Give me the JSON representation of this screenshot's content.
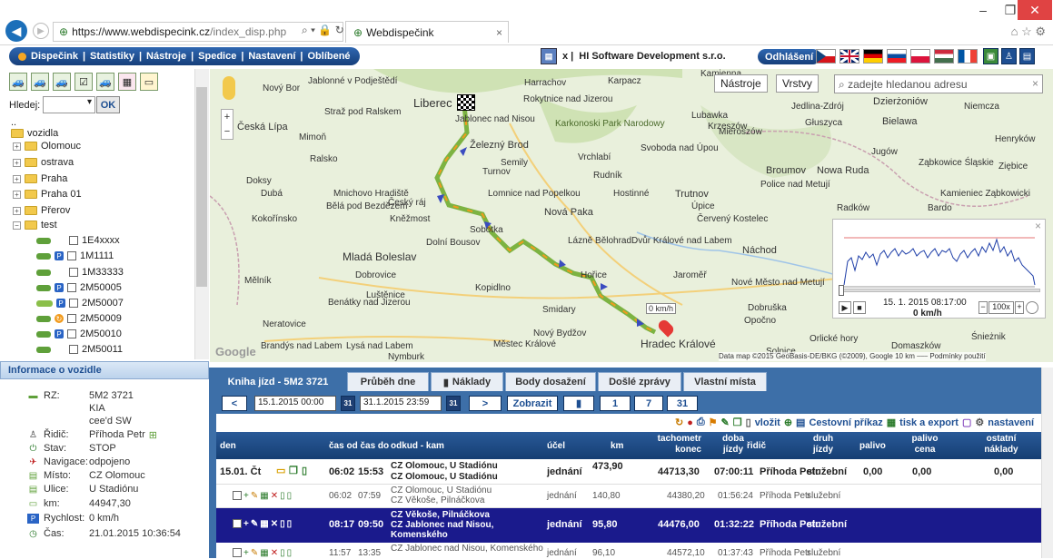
{
  "browser": {
    "url_host": "https://www.webdispecink.cz",
    "url_path": "/index_disp.php",
    "url_controls": "⌕ ▾ 🔒 ↻",
    "tab_title": "Webdispečink",
    "tab_close": "×",
    "win_min": "–",
    "win_max": "❐",
    "win_close": "✕",
    "right_icons": "⌂ ☆ ⚙"
  },
  "menu": {
    "items": [
      "Dispečink",
      "Statistiky",
      "Nástroje",
      "Spedice",
      "Nastavení",
      "Oblíbené"
    ],
    "company": "HI Software Development s.r.o.",
    "company_prefix": "x |",
    "logout": "Odhlášení",
    "flag_colors": [
      "#d7141a",
      "#012169",
      "#000000",
      "#0b4ea2",
      "#dc143c",
      "#436f4d",
      "#0055a4"
    ]
  },
  "left": {
    "search_label": "Hledej:",
    "ok": "OK",
    "tree_dots": "..",
    "root": "vozidla",
    "folders": [
      "Olomouc",
      "ostrava",
      "Praha",
      "Praha 01",
      "Přerov",
      "test"
    ],
    "vehicles": [
      "1E4xxxx",
      "1M1111",
      "1M33333",
      "2M50005",
      "2M50007",
      "2M50009",
      "2M50010",
      "2M50011"
    ]
  },
  "info": {
    "header": "Informace o vozidle",
    "rows": [
      {
        "label": "RZ:",
        "value": "5M2 3721"
      },
      {
        "label": "",
        "value": "KIA"
      },
      {
        "label": "",
        "value": "cee'd SW"
      },
      {
        "label": "Řidič:",
        "value": "Příhoda Petr"
      },
      {
        "label": "Stav:",
        "value": "STOP"
      },
      {
        "label": "Navigace:",
        "value": "odpojeno"
      },
      {
        "label": "Místo:",
        "value": "CZ Olomouc"
      },
      {
        "label": "Ulice:",
        "value": "U Stadiónu"
      },
      {
        "label": "km:",
        "value": "44947,30"
      },
      {
        "label": "Rychlost:",
        "value": "0 km/h"
      },
      {
        "label": "Čas:",
        "value": "21.01.2015 10:36:54"
      }
    ]
  },
  "map": {
    "btn_tools": "Nástroje",
    "btn_layers": "Vrstvy",
    "search_placeholder": "zadejte hledanou adresu",
    "search_clear": "×",
    "speed_badge": "0 km/h",
    "speed_time": "15. 1. 2015 08:17:00",
    "speed_value": "0 km/h",
    "speed_zoom": "100x",
    "speed_close": "×",
    "speed_minus": "−",
    "speed_plus": "+",
    "attribution": "Data map ©2015 GeoBasis-DE/BKG (©2009), Google   10 km ⎯⎯⎯   Podmínky použití",
    "google": "Google",
    "places": [
      "Liberec",
      "Jablonec nad Nisou",
      "Harrachov",
      "Karpacz",
      "Kamienna",
      "Nový Bor",
      "Jablonné v Podještědí",
      "Česká Lípa",
      "Mimoň",
      "Ralsko",
      "Straž pod Ralskem",
      "Rokytnice nad Jizerou",
      "Karkonoski Park Narodowy",
      "Krzeszów",
      "Lubawka",
      "Jedlina-Zdrój",
      "Dzierżoniów",
      "Niemcza",
      "Bielawa",
      "Głuszyca",
      "Henryków",
      "Železný Brod",
      "Semily",
      "Vrchlabí",
      "Svoboda nad Úpou",
      "Mieroszów",
      "Jugów",
      "Turnov",
      "Doksy",
      "Dubá",
      "Mnichovo Hradiště",
      "Český ráj",
      "Lomnice nad Popelkou",
      "Hostinné",
      "Trutnov",
      "Rudník",
      "Broumov",
      "Nowa Ruda",
      "Ząbkowice Śląskie",
      "Ziębice",
      "Bělá pod Bezdězem",
      "Kněžmost",
      "Nová Paka",
      "Úpice",
      "Police nad Metují",
      "Kamieniec Ząbkowicki",
      "Radków",
      "Bardo",
      "Kokořínsko",
      "Sobotka",
      "Červený Kostelec",
      "Mladá Boleslav",
      "Dolní Bousov",
      "Lázně Bělohrad",
      "Dvůr Králové nad Labem",
      "Náchod",
      "Mělník",
      "Dobrovice",
      "Hořice",
      "Jaroměř",
      "Nové Město nad Metují",
      "Kopidlno",
      "Luštěnice",
      "Benátky nad Jizerou",
      "Smidary",
      "Dobruška",
      "Opočno",
      "Neratovice",
      "Nový Bydžov",
      "Hradec Králové",
      "Brandýs nad Labem",
      "Lysá nad Labem",
      "Nymburk",
      "Městec Králové",
      "Solnice",
      "Orlické hory",
      "Domaszków",
      "Śnieżnik"
    ]
  },
  "bottom": {
    "tabs": [
      "Kniha jízd - 5M2 3721",
      "Průběh dne",
      "Náklady",
      "Body dosažení",
      "Došlé zprávy",
      "Vlastní místa"
    ],
    "filter": {
      "prev": "<",
      "next": ">",
      "from": "15.1.2015 00:00",
      "to": "31.1.2015 23:59",
      "show": "Zobrazit",
      "b1": "1",
      "b7": "7",
      "b31": "31",
      "cal": "31"
    },
    "toolbar": {
      "insert": "vložit",
      "travel_order": "Cestovní příkaz",
      "print_export": "tisk a export",
      "settings": "nastavení"
    },
    "headers": {
      "den": "den",
      "cas": "čas od čas do",
      "odkud": "odkud - kam",
      "ucel": "účel",
      "km": "km",
      "tacho": "tachometr konec",
      "doba": "doba jízdy",
      "ridic": "řidič",
      "druh": "druh jízdy",
      "palivo": "palivo",
      "palivo_cena": "palivo cena",
      "ostatni": "ostatní náklady"
    },
    "rows": [
      {
        "den": "15.01. Čt",
        "od": "06:02",
        "do": "15:53",
        "odkud": "CZ Olomouc, U Stadiónu",
        "kam": "CZ Olomouc, U Stadiónu",
        "ucel": "jednání",
        "km": "473,90",
        "tacho": "44713,30",
        "doba": "07:00:11",
        "ridic": "Příhoda Petr",
        "druh": "služební",
        "palivo": "0,00",
        "cena": "0,00",
        "ostatni": "0,00"
      },
      {
        "den": "",
        "od": "06:02",
        "do": "07:59",
        "odkud": "CZ Olomouc, U Stadiónu",
        "kam": "CZ Věkoše, Pilnáčkova",
        "ucel": "jednání",
        "km": "140,80",
        "tacho": "44380,20",
        "doba": "01:56:24",
        "ridic": "Příhoda Petr",
        "druh": "služební",
        "palivo": "",
        "cena": "",
        "ostatni": ""
      },
      {
        "den": "",
        "od": "08:17",
        "do": "09:50",
        "odkud": "CZ Věkoše, Pilnáčkova",
        "kam": "CZ Jablonec nad Nisou, Komenského",
        "ucel": "jednání",
        "km": "95,80",
        "tacho": "44476,00",
        "doba": "01:32:22",
        "ridic": "Příhoda Petr",
        "druh": "služební",
        "palivo": "",
        "cena": "",
        "ostatni": ""
      },
      {
        "den": "",
        "od": "11:57",
        "do": "13:35",
        "odkud": "CZ Jablonec nad Nisou, Komenského",
        "kam": "",
        "ucel": "jednání",
        "km": "96,10",
        "tacho": "44572,10",
        "doba": "01:37:43",
        "ridic": "Příhoda Petr",
        "druh": "služební",
        "palivo": "",
        "cena": "",
        "ostatni": ""
      }
    ]
  }
}
